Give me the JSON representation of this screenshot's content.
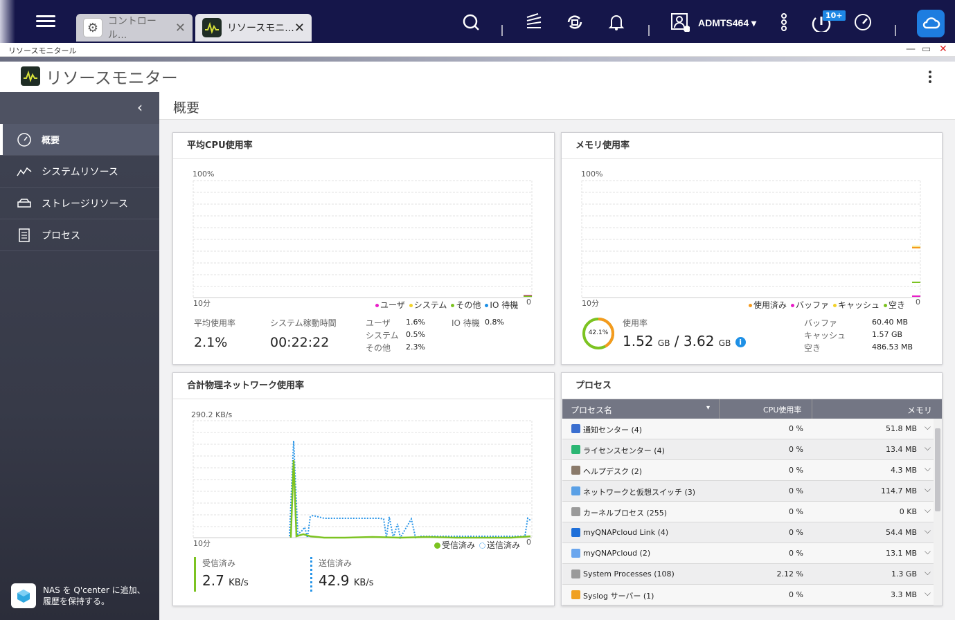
{
  "topbar": {
    "tabs": [
      {
        "label": "コントロール..."
      },
      {
        "label": "リソースモニ..."
      }
    ],
    "user": "ADMTS464",
    "notification_badge": "10+"
  },
  "window": {
    "title": "リソースモニタール",
    "controls": [
      "—",
      "▭",
      "✕"
    ]
  },
  "app": {
    "title": "リソースモニター"
  },
  "sidebar": {
    "items": [
      {
        "label": "概要"
      },
      {
        "label": "システムリソース"
      },
      {
        "label": "ストレージリソース"
      },
      {
        "label": "プロセス"
      }
    ],
    "qcenter_line1": "NAS を Q'center に追加、",
    "qcenter_line2": "履歴を保持する。"
  },
  "main": {
    "heading": "概要"
  },
  "cpu": {
    "title": "平均CPU使用率",
    "y_max": "100%",
    "x_label": "10分",
    "zero": "0",
    "legend": [
      "ユーザ",
      "システム",
      "その他",
      "IO 待機"
    ],
    "avg_label": "平均使用率",
    "avg_value": "2.1%",
    "uptime_label": "システム稼動時間",
    "uptime_value": "00:22:22",
    "user_label": "ユーザ",
    "user_value": "1.6%",
    "system_label": "システム",
    "system_value": "0.5%",
    "other_label": "その他",
    "other_value": "2.3%",
    "io_label": "IO 待機",
    "io_value": "0.8%"
  },
  "memory": {
    "title": "メモリ使用率",
    "y_max": "100%",
    "x_label": "10分",
    "zero": "0",
    "legend": [
      "使用済み",
      "バッファ",
      "キャッシュ",
      "空き"
    ],
    "ring_pct": "42.1%",
    "usage_label": "使用率",
    "used": "1.52",
    "used_unit": "GB",
    "slash": "/",
    "total": "3.62",
    "total_unit": "GB",
    "buffer_label": "バッファ",
    "buffer_value": "60.40 MB",
    "cache_label": "キャッシュ",
    "cache_value": "1.57 GB",
    "free_label": "空き",
    "free_value": "486.53 MB"
  },
  "network": {
    "title": "合計物理ネットワーク使用率",
    "y_max": "290.2 KB/s",
    "x_label": "10分",
    "zero": "0",
    "legend": [
      "受信済み",
      "送信済み"
    ],
    "rx_label": "受信済み",
    "rx_value": "2.7",
    "rx_unit": "KB/s",
    "tx_label": "送信済み",
    "tx_value": "42.9",
    "tx_unit": "KB/s"
  },
  "process": {
    "title": "プロセス",
    "col_name": "プロセス名",
    "col_cpu": "CPU使用率",
    "col_mem": "メモリ",
    "rows": [
      {
        "name": "通知センター (4)",
        "cpu": "0 %",
        "mem": "51.8 MB",
        "color": "#3b6fd0"
      },
      {
        "name": "ライセンスセンター (4)",
        "cpu": "0 %",
        "mem": "13.4 MB",
        "color": "#2bb673"
      },
      {
        "name": "ヘルプデスク (2)",
        "cpu": "0 %",
        "mem": "4.3 MB",
        "color": "#8a7a6a"
      },
      {
        "name": "ネットワークと仮想スイッチ (3)",
        "cpu": "0 %",
        "mem": "114.7 MB",
        "color": "#5aa0e6"
      },
      {
        "name": "カーネルプロセス (255)",
        "cpu": "0 %",
        "mem": "0 KB",
        "color": "#9a9a9a"
      },
      {
        "name": "myQNAPcloud Link (4)",
        "cpu": "0 %",
        "mem": "54.4 MB",
        "color": "#1e6fd9"
      },
      {
        "name": "myQNAPcloud (2)",
        "cpu": "0 %",
        "mem": "13.1 MB",
        "color": "#6aa6ee"
      },
      {
        "name": "System Processes (108)",
        "cpu": "2.12 %",
        "mem": "1.3 GB",
        "color": "#9a9a9a"
      },
      {
        "name": "Syslog サーバー (1)",
        "cpu": "0 %",
        "mem": "3.3 MB",
        "color": "#f0a020"
      }
    ]
  },
  "colors": {
    "accent": "#1e7de0",
    "user": "#e91ec8",
    "system": "#f2d22a",
    "other": "#7cc321",
    "io": "#1e90e6",
    "used": "#f59a1e",
    "rx": "#7cc321",
    "tx": "#2a96e8"
  }
}
